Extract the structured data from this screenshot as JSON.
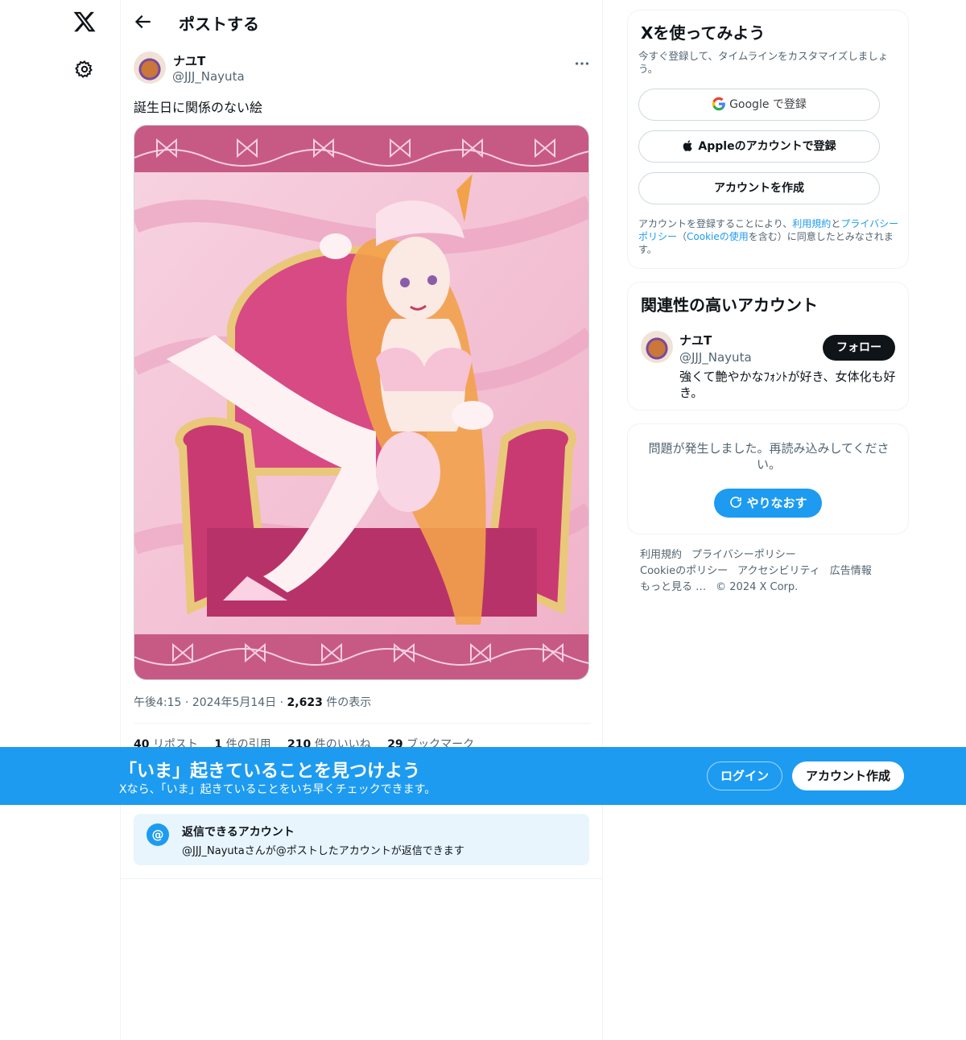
{
  "nav": {
    "logo_icon": "x-logo",
    "settings_icon": "gear-icon"
  },
  "header": {
    "title": "ポストする",
    "back_icon": "arrow-left-icon"
  },
  "post": {
    "author_name": "ナユT",
    "author_handle": "@JJJ_Nayuta",
    "text": "誕生日に関係のない絵",
    "time": "午後4:15",
    "date": "2024年5月14日",
    "views_count": "2,623",
    "views_label": "件の表示",
    "stats": [
      {
        "count": "40",
        "label": "リポスト"
      },
      {
        "count": "1",
        "label": "件の引用"
      },
      {
        "count": "210",
        "label": "件のいいね"
      },
      {
        "count": "29",
        "label": "ブックマーク"
      }
    ],
    "reply_restriction": {
      "icon_text": "@",
      "title": "返信できるアカウント",
      "subtitle": "@JJJ_Nayutaさんが@ポストしたアカウントが返信できます"
    }
  },
  "signup_card": {
    "title": "Xを使ってみよう",
    "subtitle": "今すぐ登録して、タイムラインをカスタマイズしましょう。",
    "google_button": "Google で登録",
    "apple_button": "Appleのアカウントで登録",
    "create_button": "アカウントを作成",
    "terms_prefix": "アカウントを登録することにより、",
    "terms_link": "利用規約",
    "terms_and": "と",
    "privacy_link": "プライバシーポリシー",
    "terms_paren_open": "（",
    "cookie_link": "Cookieの使用",
    "terms_suffix": "を含む）に同意したとみなされます。"
  },
  "relevant_card": {
    "title": "関連性の高いアカウント",
    "name": "ナユT",
    "handle": "@JJJ_Nayuta",
    "follow_button": "フォロー",
    "bio": "強くて艶やかなﾌｫﾝﾄが好き、女体化も好き。"
  },
  "error_card": {
    "message": "問題が発生しました。再読み込みしてください。",
    "retry_button": "やりなおす"
  },
  "footer": {
    "links": [
      "利用規約",
      "プライバシーポリシー",
      "Cookieのポリシー",
      "アクセシビリティ",
      "広告情報",
      "もっと見る …",
      "© 2024 X Corp."
    ]
  },
  "bottom_bar": {
    "title": "「いま」起きていることを見つけよう",
    "subtitle": "Xなら、「いま」起きていることをいち早くチェックできます。",
    "login_button": "ログイン",
    "signup_button": "アカウント作成"
  },
  "colors": {
    "accent": "#1d9bf0",
    "text_primary": "#0f1419",
    "text_secondary": "#536471",
    "illustration_frame": "#c75a85",
    "illustration_bg": "#f5c6d8"
  }
}
